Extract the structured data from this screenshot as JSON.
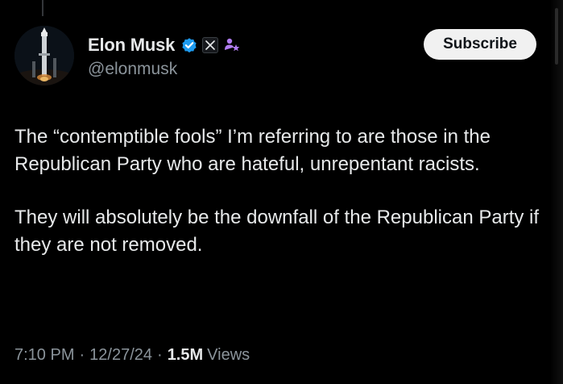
{
  "author": {
    "display_name": "Elon Musk",
    "handle": "@elonmusk",
    "badges": [
      "verified-icon",
      "x-icon",
      "affiliate-icon"
    ]
  },
  "subscribe_label": "Subscribe",
  "tweet": {
    "paragraphs": [
      "The “contemptible fools” I’m referring to are those in the Republican Party who are hateful, unrepentant racists.",
      "They will absolutely be the downfall of the Republican Party if they are not removed."
    ],
    "time": "7:10 PM",
    "separator": "·",
    "date": "12/27/24",
    "views_count": "1.5M",
    "views_label": "Views"
  },
  "colors": {
    "background": "#000000",
    "text": "#e7e9ea",
    "secondary": "#8b949b",
    "verified": "#1d9bf0",
    "affiliate": "#b07cf0"
  }
}
